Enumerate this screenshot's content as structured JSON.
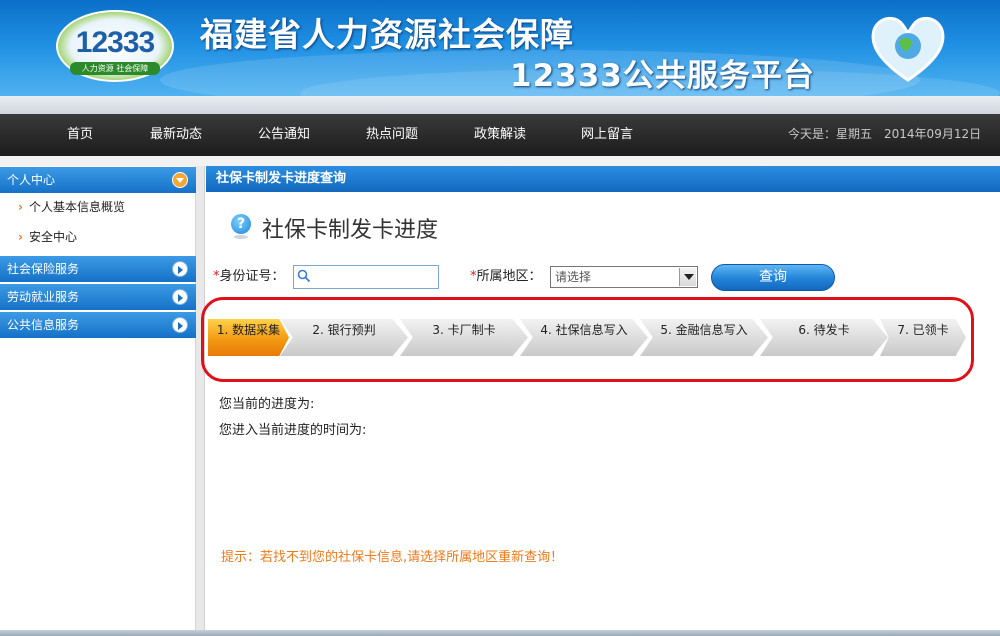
{
  "header": {
    "logo_number": "12333",
    "logo_subtitle": "人力资源 社会保障",
    "title_line1": "福建省人力资源社会保障",
    "title_line2": "12333公共服务平台"
  },
  "nav": {
    "items": [
      {
        "label": "首页"
      },
      {
        "label": "最新动态"
      },
      {
        "label": "公告通知"
      },
      {
        "label": "热点问题"
      },
      {
        "label": "政策解读"
      },
      {
        "label": "网上留言"
      }
    ],
    "today_label": "今天是：星期五",
    "date": "2014年09月12日"
  },
  "sidebar": {
    "sections": [
      {
        "label": "个人中心",
        "expanded": true
      },
      {
        "label": "社会保险服务"
      },
      {
        "label": "劳动就业服务"
      },
      {
        "label": "公共信息服务"
      }
    ],
    "links": [
      {
        "label": "个人基本信息概览"
      },
      {
        "label": "安全中心"
      }
    ]
  },
  "main": {
    "section_title": "社保卡制发卡进度查询",
    "page_title": "社保卡制发卡进度",
    "form": {
      "id_label": "身份证号：",
      "id_value": "",
      "region_label": "所属地区：",
      "region_selected": "请选择",
      "query_button": "查询"
    },
    "steps": [
      {
        "label": "1. 数据采集",
        "active": true
      },
      {
        "label": "2. 银行预判"
      },
      {
        "label": "3. 卡厂制卡"
      },
      {
        "label": "4. 社保信息写入"
      },
      {
        "label": "5. 金融信息写入"
      },
      {
        "label": "6. 待发卡"
      },
      {
        "label": "7. 已领卡"
      }
    ],
    "current_progress_label": "您当前的进度为:",
    "enter_time_label": "您进入当前进度的时间为:",
    "tip": "提示：若找不到您的社保卡信息,请选择所属地区重新查询！"
  },
  "colors": {
    "header_blue": "#1e8fe3",
    "nav_dark": "#262626",
    "accent_blue": "#1571c7",
    "step_active": "#f39a12",
    "tip_orange": "#f07a1a",
    "highlight_red": "#e0101a"
  }
}
